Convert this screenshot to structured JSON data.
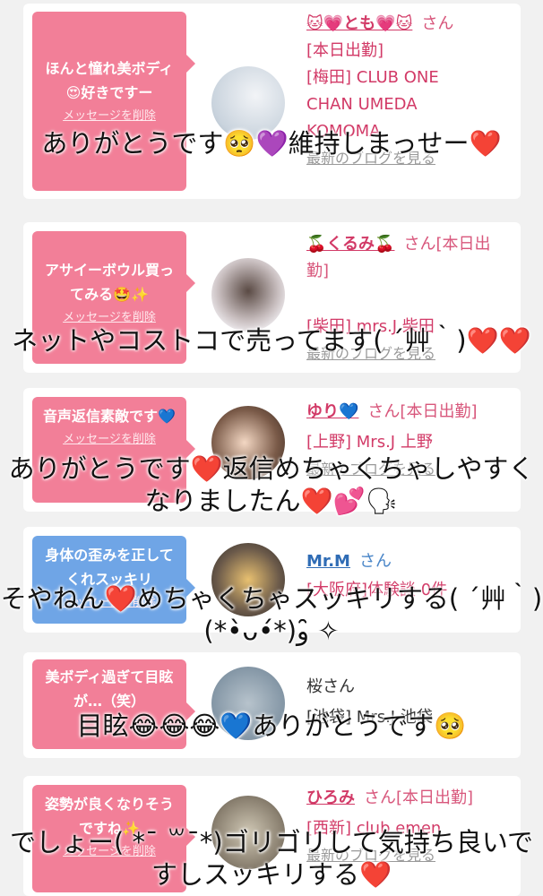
{
  "cards": [
    {
      "bubble": "ほんと憧れ美ボディ😍好きですー",
      "delete_label": "メッセージを削除",
      "name": "🐱💗とも💗🐱",
      "san": "さん",
      "status": "[本日出勤]",
      "shop_line1": "[梅田] CLUB ONE",
      "shop_line2": "CHAN UMEDA",
      "shop_line3": "KOMOMA",
      "blog": "最新のブログを見る",
      "caption": "ありがとうです🥺💜維持しまっせー❤️"
    },
    {
      "bubble": "アサイーボウル買ってみる🤩✨",
      "delete_label": "メッセージを削除",
      "name": "🍒くるみ🍒",
      "san": "さん[本日出勤]",
      "shop": "[柴田] mrs.J 柴田",
      "blog": "最新のブログを見る",
      "caption": "ネットやコストコで売ってます( ´艸｀)❤️❤️"
    },
    {
      "bubble": "音声返信素敵です💙",
      "delete_label": "メッセージを削除",
      "name": "ゆり💙",
      "san": "さん[本日出勤]",
      "shop": "[上野] Mrs.J 上野",
      "blog": "最新のブログを見る",
      "caption": "ありがとうです❤️返信めちゃくちゃしやすくなりましたん❤️💕🗣"
    },
    {
      "bubble": "身体の歪みを正してくれスッキリ",
      "delete_label": "メッセージを削除",
      "name": "Mr.M",
      "san": "さん",
      "shop": "[大阪府]体験談 0件",
      "caption": "そやねん❤️めちゃくちゃスッキリする( ´艸｀)(*•̀ᴗ•́*)و ̑̑✧"
    },
    {
      "bubble": "美ボディ過ぎて目眩が…（笑）",
      "name": "桜さん",
      "shop": "[池袋] Mrs.J 池袋",
      "caption": "目眩😂😂😂💙ありがとうです🥺"
    },
    {
      "bubble": "姿勢が良くなりそうですね✨",
      "delete_label": "メッセージを削除",
      "name": "ひろみ",
      "san": "さん[本日出勤]",
      "shop": "[西新] club emen",
      "blog": "最新のブログを見る",
      "caption": "でしょー( *¯ ꒳¯*)ゴリゴリして気持ち良いですしスッキリする❤️"
    }
  ],
  "colors": {
    "bubble_pink": "#f27f98",
    "bubble_blue": "#6fa5e6",
    "name_pink": "#d23a67",
    "name_blue": "#2f6cb5",
    "background": "#f1f1f1"
  }
}
